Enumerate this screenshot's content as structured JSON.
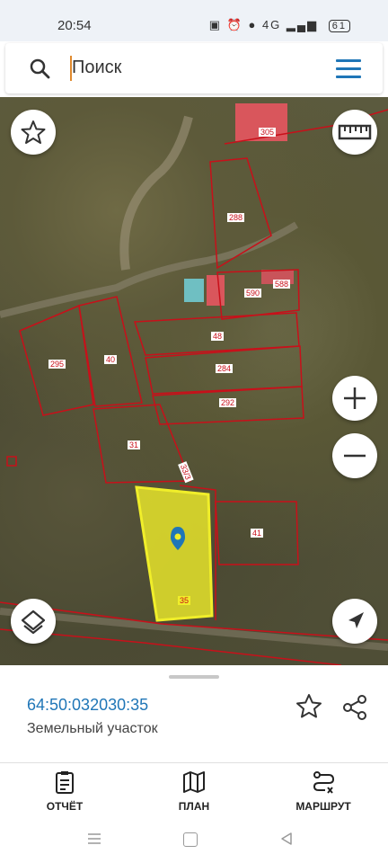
{
  "status_bar": {
    "time": "20:54",
    "network": "4G",
    "battery": "61"
  },
  "search": {
    "placeholder": "Поиск"
  },
  "map": {
    "parcel_labels": [
      "305",
      "288",
      "590",
      "588",
      "48",
      "295",
      "40",
      "284",
      "292",
      "31",
      "33/3",
      "41",
      "35"
    ],
    "selected_parcel_color": "#f0ee2a",
    "boundary_color": "#c8101a"
  },
  "sheet": {
    "cadastral_number": "64:50:032030:35",
    "parcel_type": "Земельный участок"
  },
  "actions": [
    {
      "label": "ОТЧЁТ",
      "icon": "report-icon"
    },
    {
      "label": "ПЛАН",
      "icon": "map-plan-icon"
    },
    {
      "label": "МАРШРУТ",
      "icon": "route-icon"
    }
  ],
  "colors": {
    "accent": "#1f76b7",
    "selected_parcel": "#f0ee2a",
    "boundary": "#c8101a"
  }
}
